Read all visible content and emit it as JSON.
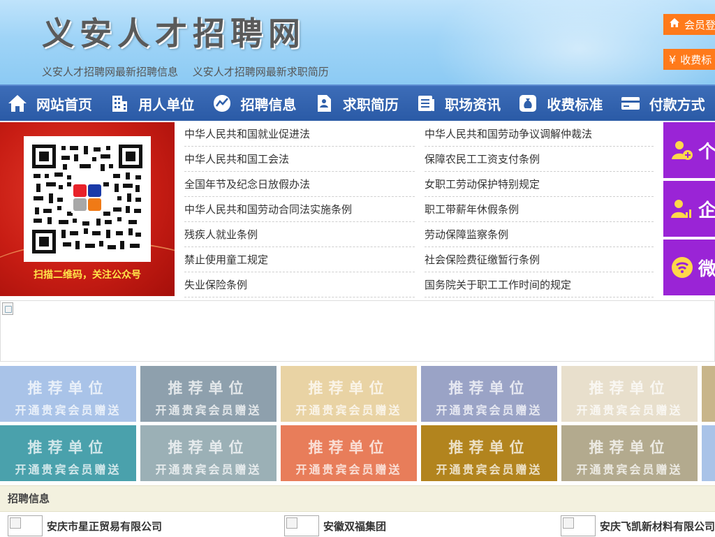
{
  "header": {
    "site_title": "义安人才招聘网",
    "sub_links": [
      "义安人才招聘网最新招聘信息",
      "义安人才招聘网最新求职简历"
    ],
    "login_button": "会员登",
    "fee_button": "收费标"
  },
  "nav": {
    "items": [
      {
        "label": "网站首页",
        "icon": "home-icon"
      },
      {
        "label": "用人单位",
        "icon": "building-icon"
      },
      {
        "label": "招聘信息",
        "icon": "chart-icon"
      },
      {
        "label": "求职简历",
        "icon": "resume-icon"
      },
      {
        "label": "职场资讯",
        "icon": "news-icon"
      },
      {
        "label": "收费标准",
        "icon": "money-bag-icon"
      },
      {
        "label": "付款方式",
        "icon": "card-icon"
      }
    ]
  },
  "qr_banner": {
    "caption": "扫描二维码，关注公众号"
  },
  "laws": {
    "left": [
      "中华人民共和国就业促进法",
      "中华人民共和国工会法",
      "全国年节及纪念日放假办法",
      "中华人民共和国劳动合同法实施条例",
      "残疾人就业条例",
      "禁止使用童工规定",
      "失业保险条例"
    ],
    "right": [
      "中华人民共和国劳动争议调解仲裁法",
      "保障农民工工资支付条例",
      "女职工劳动保护特别规定",
      "职工带薪年休假条例",
      "劳动保障监察条例",
      "社会保险费征缴暂行条例",
      "国务院关于职工工作时间的规定"
    ]
  },
  "side_buttons": [
    {
      "label": "个",
      "icon": "person-add-icon"
    },
    {
      "label": "企",
      "icon": "person-chart-icon"
    },
    {
      "label": "微",
      "icon": "wechat-icon"
    }
  ],
  "promo": {
    "line1": "推荐单位",
    "line2": "开通贵宾会员赠送",
    "row1_colors": [
      "#a9c3e8",
      "#8ea0ad",
      "#e9d3a4",
      "#9aa3c6",
      "#e8dfcc",
      "#c8b58a"
    ],
    "row2_colors": [
      "#4aa1ac",
      "#9bb0b6",
      "#e87d5a",
      "#b2841e",
      "#b3aa8e",
      "#a9c3e8"
    ]
  },
  "recruit": {
    "title": "招聘信息",
    "companies": [
      "安庆市星正贸易有限公司",
      "安徽双福集团",
      "安庆飞凯新材料有限公司"
    ]
  }
}
